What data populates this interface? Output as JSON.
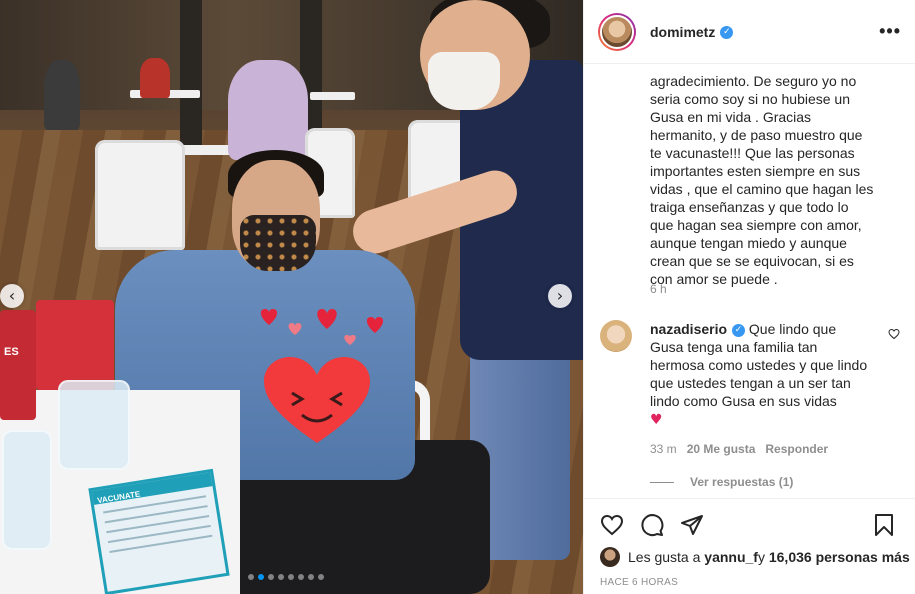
{
  "post": {
    "username": "domimetz",
    "caption": "agradecimiento. De seguro yo no seria como soy si no hubiese un Gusa en mi vida . Gracias hermanito, y de paso muestro que te vacunaste!!! Que las personas importantes esten siempre en sus vidas , que el camino que hagan les traiga enseñanzas y que todo lo que hagan sea siempre con amor, aunque tengan miedo y aunque crean que se se equivocan, si es con amor se puede .",
    "caption_time": "6 h"
  },
  "photo": {
    "card_title": "VACUNATE",
    "box_label": "ES",
    "dots_total": 8,
    "dots_active_index": 1
  },
  "comment": {
    "username": "nazadiserio",
    "text": "Que lindo que Gusa tenga una familia tan hermosa como ustedes y que lindo que ustedes tengan a un ser tan lindo como Gusa en sus vidas",
    "emoji": "♥",
    "time": "33 m",
    "likes": "20 Me gusta",
    "reply_label": "Responder",
    "view_replies": "Ver respuestas (1)"
  },
  "footer": {
    "likes_prefix": "Les gusta a ",
    "likes_user": "yannu_f",
    "likes_middle": " y ",
    "likes_count": "16,036 personas más",
    "ago": "HACE 6 HORAS"
  },
  "icons": {
    "more": "more-options-icon",
    "like": "heart-icon",
    "comment": "comment-icon",
    "share": "share-icon",
    "save": "bookmark-icon",
    "verified": "verified-badge-icon"
  },
  "colors": {
    "accent": "#0095f6",
    "verified": "#3897f0",
    "muted": "#8e8e8e",
    "heart": "#e0245e"
  }
}
